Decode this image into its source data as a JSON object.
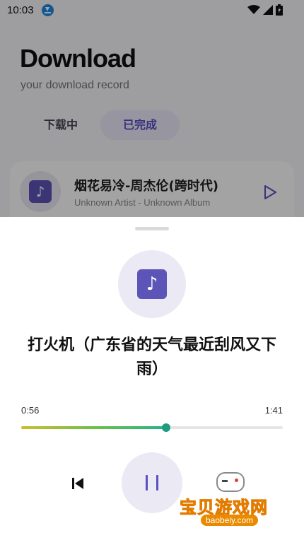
{
  "status_bar": {
    "time": "10:03",
    "icons": [
      "download-notification-icon",
      "wifi-icon",
      "signal-icon",
      "battery-icon"
    ]
  },
  "page": {
    "title": "Download",
    "subtitle": "your download record",
    "tabs": [
      {
        "label": "下载中",
        "active": false
      },
      {
        "label": "已完成",
        "active": true
      }
    ]
  },
  "records": [
    {
      "title": "烟花易冷-周杰伦(跨时代)",
      "meta": "Unknown Artist - Unknown Album",
      "icon": "music-note-icon",
      "action_icon": "play-icon"
    }
  ],
  "player": {
    "title": "打火机（广东省的天气最近刮风又下雨）",
    "current_time": "0:56",
    "total_time": "1:41",
    "progress_fraction": 0.553,
    "controls": {
      "prev_icon": "skip-previous-icon",
      "pause_icon": "pause-icon"
    }
  },
  "watermark": {
    "text": "宝贝游戏网",
    "url": "baobeiy.com"
  },
  "colors": {
    "accent": "#5b4fc4",
    "art_bg": "#ebe9f3",
    "note_bg": "#5d54b8",
    "progress_start": "#cbbd2e",
    "progress_end": "#24b389"
  }
}
